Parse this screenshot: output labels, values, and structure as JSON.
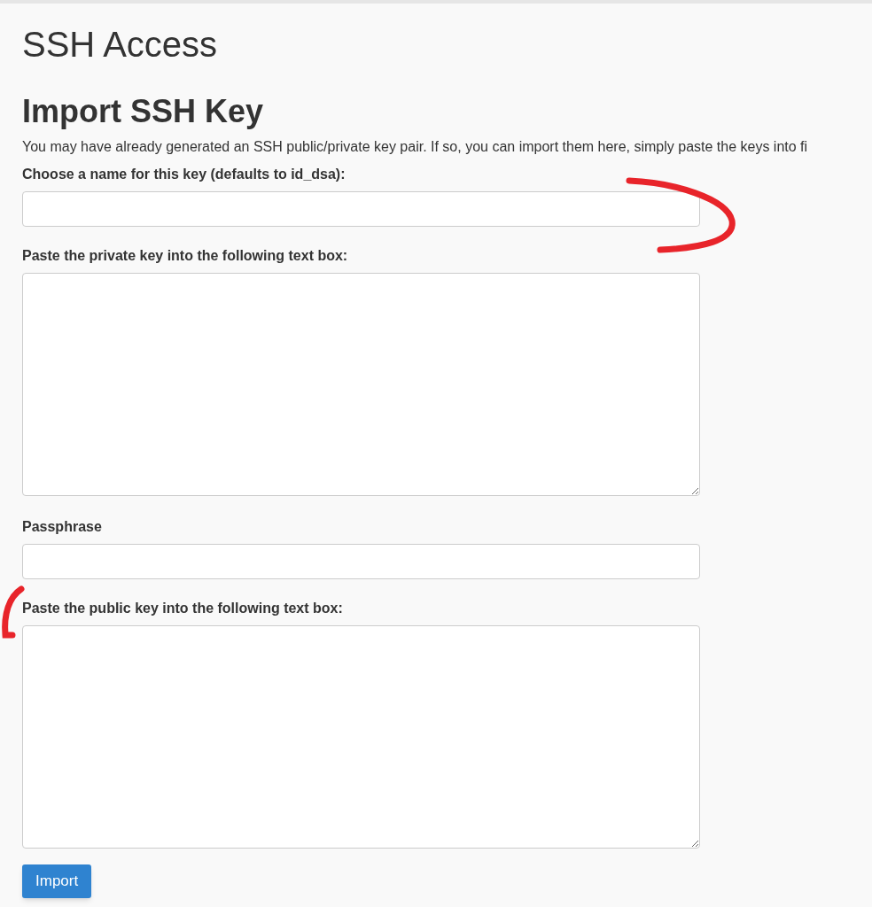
{
  "page_title": "SSH Access",
  "section_title": "Import SSH Key",
  "description": "You may have already generated an SSH public/private key pair. If so, you can import them here, simply paste the keys into fi",
  "fields": [
    {
      "kind": "input",
      "label": "Choose a name for this key (defaults to id_dsa):"
    },
    {
      "kind": "textarea",
      "label": "Paste the private key into the following text box:"
    },
    {
      "kind": "input",
      "label": "Passphrase"
    },
    {
      "kind": "textarea",
      "label": "Paste the public key into the following text box:"
    }
  ],
  "submit_button": "Import"
}
